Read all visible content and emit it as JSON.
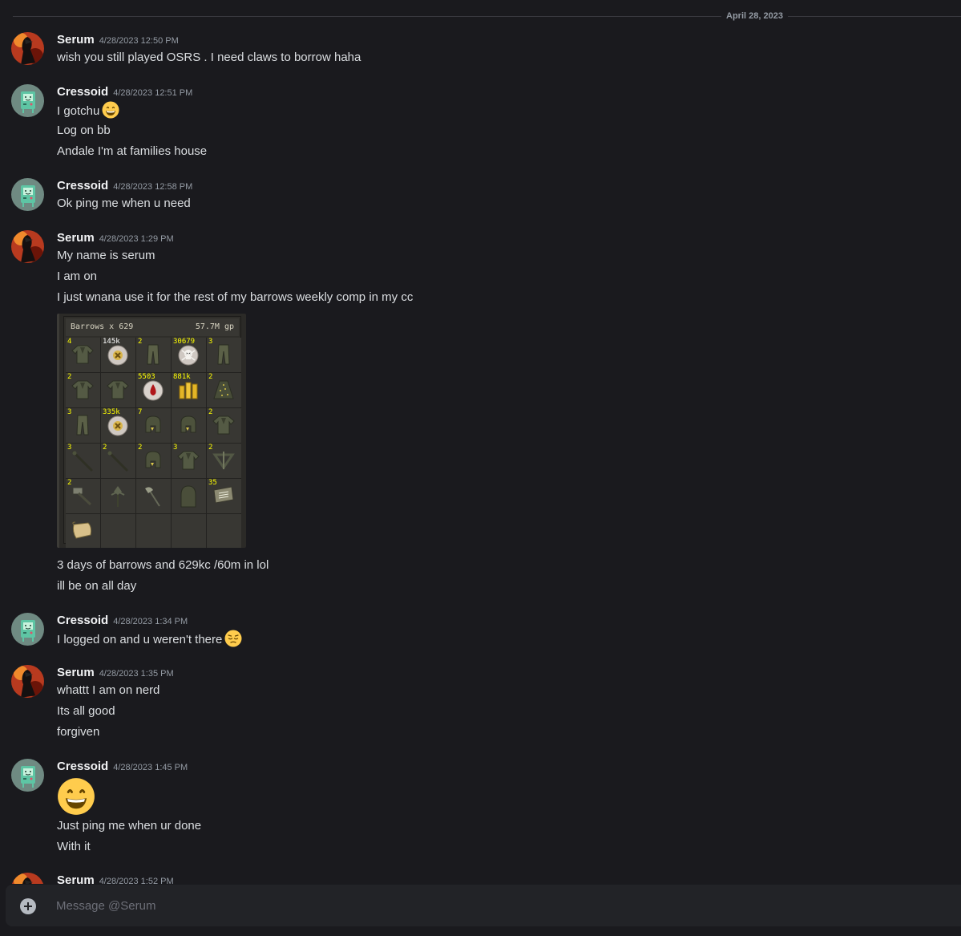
{
  "date_divider": "April 28, 2023",
  "colors": {
    "background": "#1a1a1e",
    "text": "#dbdee1",
    "muted": "#949ba4",
    "author": "#f2f3f5"
  },
  "messages": [
    {
      "author": "Serum",
      "avatar": "serum-avatar",
      "timestamp": "4/28/2023 12:50 PM",
      "lines": [
        "wish you still played OSRS . I need claws to borrow haha"
      ]
    },
    {
      "author": "Cressoid",
      "avatar": "cressoid-avatar",
      "timestamp": "4/28/2023 12:51 PM",
      "lines": [
        "I gotchu",
        "Log on bb",
        "Andale I'm at families house"
      ],
      "line0_emoji": "grinning-face-emoji"
    },
    {
      "author": "Cressoid",
      "avatar": "cressoid-avatar",
      "timestamp": "4/28/2023 12:58 PM",
      "lines": [
        "Ok ping me when u need"
      ]
    },
    {
      "author": "Serum",
      "avatar": "serum-avatar",
      "timestamp": "4/28/2023 1:29 PM",
      "lines": [
        "My name is serum",
        "I am on",
        "I just wnana use it for the rest of my barrows weekly comp in my cc"
      ],
      "after_attachment": [
        "3 days of barrows and  629kc /60m in lol",
        "ill be on all day"
      ]
    },
    {
      "author": "Cressoid",
      "avatar": "cressoid-avatar",
      "timestamp": "4/28/2023 1:34 PM",
      "lines": [
        "I logged on and u weren't there"
      ],
      "line0_emoji": "pensive-face-emoji"
    },
    {
      "author": "Serum",
      "avatar": "serum-avatar",
      "timestamp": "4/28/2023 1:35 PM",
      "lines": [
        "whattt I am on nerd",
        "Its all good",
        "forgiven"
      ]
    },
    {
      "author": "Cressoid",
      "avatar": "cressoid-avatar",
      "timestamp": "4/28/2023 1:45 PM",
      "jumbo_emoji": "grinning-face-emoji",
      "lines": [
        "Just ping me when ur done",
        "With it"
      ]
    },
    {
      "author": "Serum",
      "avatar": "serum-avatar",
      "timestamp": "4/28/2023 1:52 PM"
    }
  ],
  "attachment": {
    "title": "Barrows x 629",
    "value": "57.7M gp",
    "slots": [
      {
        "qty": "4",
        "icon": "body-armour"
      },
      {
        "qty": "145k",
        "icon": "rune",
        "qty_white": true
      },
      {
        "qty": "2",
        "icon": "legs"
      },
      {
        "qty": "30679",
        "icon": "death-rune"
      },
      {
        "qty": "3",
        "icon": "legs"
      },
      {
        "qty": "2",
        "icon": "body-armour"
      },
      {
        "qty": "",
        "icon": "body-armour"
      },
      {
        "qty": "5503",
        "icon": "blood-rune"
      },
      {
        "qty": "881k",
        "icon": "bolt-racks"
      },
      {
        "qty": "2",
        "icon": "skirt"
      },
      {
        "qty": "3",
        "icon": "legs"
      },
      {
        "qty": "335k",
        "icon": "rune"
      },
      {
        "qty": "7",
        "icon": "helm"
      },
      {
        "qty": "",
        "icon": "helm"
      },
      {
        "qty": "2",
        "icon": "body-armour"
      },
      {
        "qty": "3",
        "icon": "staff"
      },
      {
        "qty": "2",
        "icon": "staff"
      },
      {
        "qty": "2",
        "icon": "helm"
      },
      {
        "qty": "3",
        "icon": "body-armour"
      },
      {
        "qty": "2",
        "icon": "crossbow"
      },
      {
        "qty": "2",
        "icon": "hammer"
      },
      {
        "qty": "",
        "icon": "spear"
      },
      {
        "qty": "",
        "icon": "axe"
      },
      {
        "qty": "",
        "icon": "hood"
      },
      {
        "qty": "35",
        "icon": "scroll-box"
      },
      {
        "qty": "",
        "icon": "clue-scroll"
      },
      {
        "qty": "",
        "icon": ""
      },
      {
        "qty": "",
        "icon": ""
      },
      {
        "qty": "",
        "icon": ""
      },
      {
        "qty": "",
        "icon": ""
      }
    ]
  },
  "composer": {
    "placeholder": "Message @Serum"
  }
}
